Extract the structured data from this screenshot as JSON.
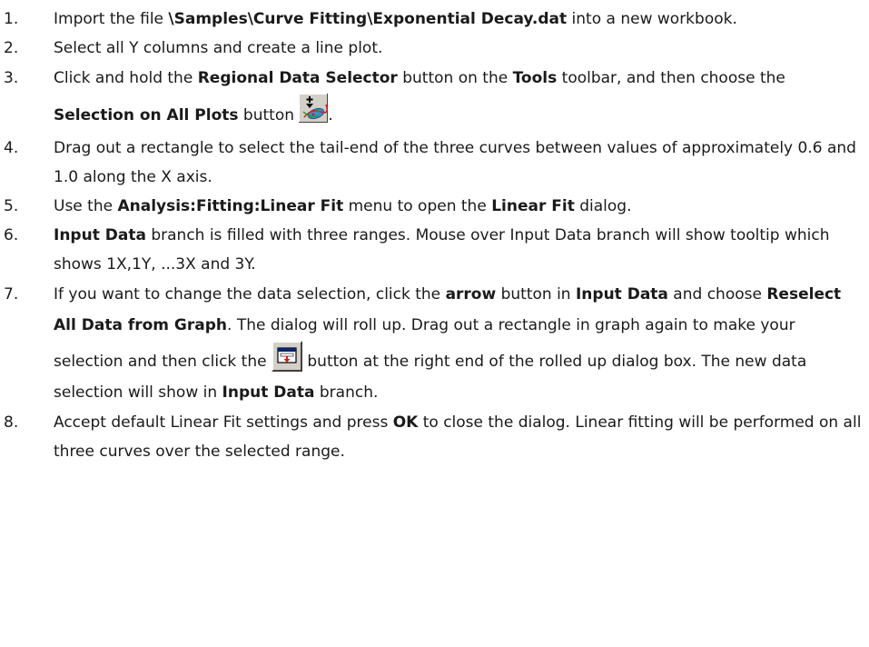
{
  "steps": [
    {
      "num": "1.",
      "t1": "Import the file ",
      "b1": "\\Samples\\Curve Fitting\\Exponential Decay.dat",
      "t2": " into a new workbook."
    },
    {
      "num": "2.",
      "t1": "Select all Y columns and create a line plot."
    },
    {
      "num": "3.",
      "t1": "Click and hold the ",
      "b1": "Regional Data Selector",
      "t2": " button on the ",
      "b2": "Tools",
      "t3": " toolbar, and then choose the ",
      "b3": "Selection on All Plots",
      "t4": " button ",
      "t5": ".",
      "icon": "selection-on-all-plots-icon"
    },
    {
      "num": "4.",
      "t1": "Drag out a rectangle to select the tail-end of the three curves between values of approximately 0.6 and 1.0 along the X axis."
    },
    {
      "num": "5.",
      "t1": "Use the ",
      "b1": "Analysis:Fitting:Linear Fit",
      "t2": " menu to open the ",
      "b2": "Linear Fit",
      "t3": " dialog."
    },
    {
      "num": "6.",
      "b1": "Input Data",
      "t1": " branch is filled with three ranges. Mouse over Input Data branch will show tooltip which shows 1X,1Y, ...3X and 3Y."
    },
    {
      "num": "7.",
      "t1": "If you want to change the data selection, click the ",
      "b1": "arrow",
      "t2": " button in ",
      "b2": "Input Data",
      "t3": " and choose ",
      "b3": "Reselect All Data from Graph",
      "t4": ". The dialog will roll up. Drag out a rectangle in graph again to make your selection and then click the ",
      "t5": " button at the right end of the rolled up dialog box. The new data selection will show in ",
      "b4": "Input Data",
      "t6": " branch.",
      "icon": "roll-down-dialog-icon"
    },
    {
      "num": "8.",
      "t1": "Accept default Linear Fit settings and press ",
      "b1": "OK",
      "t2": " to close the dialog. Linear fitting will be performed on all three curves over the selected range."
    }
  ]
}
